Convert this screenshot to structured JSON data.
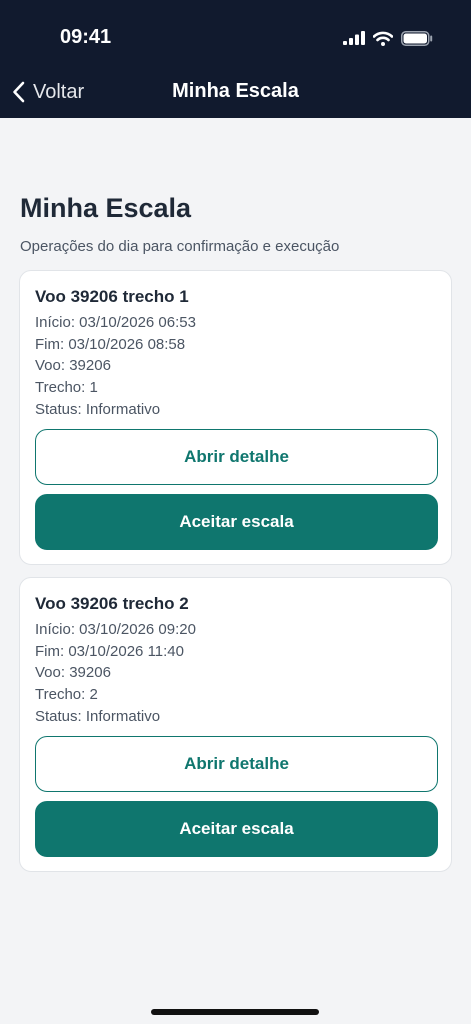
{
  "status_bar": {
    "time": "09:41"
  },
  "nav": {
    "back_label": "Voltar",
    "title": "Minha Escala"
  },
  "page": {
    "heading": "Minha Escala",
    "subtitle": "Operações do dia para confirmação e execução"
  },
  "cards": [
    {
      "title": "Voo 39206 trecho 1",
      "inicio": "Início: 03/10/2026 06:53",
      "fim": "Fim: 03/10/2026 08:58",
      "voo": "Voo: 39206",
      "trecho": "Trecho: 1",
      "status": "Status: Informativo",
      "detail_label": "Abrir detalhe",
      "accept_label": "Aceitar escala"
    },
    {
      "title": "Voo 39206 trecho 2",
      "inicio": "Início: 03/10/2026 09:20",
      "fim": "Fim: 03/10/2026 11:40",
      "voo": "Voo: 39206",
      "trecho": "Trecho: 2",
      "status": "Status: Informativo",
      "detail_label": "Abrir detalhe",
      "accept_label": "Aceitar escala"
    }
  ],
  "colors": {
    "header_bg": "#111a2e",
    "accent": "#0f766e",
    "page_bg": "#f3f4f6"
  },
  "icons": {
    "back": "chevron-left-icon",
    "signal": "signal-icon",
    "wifi": "wifi-icon",
    "battery": "battery-icon"
  }
}
